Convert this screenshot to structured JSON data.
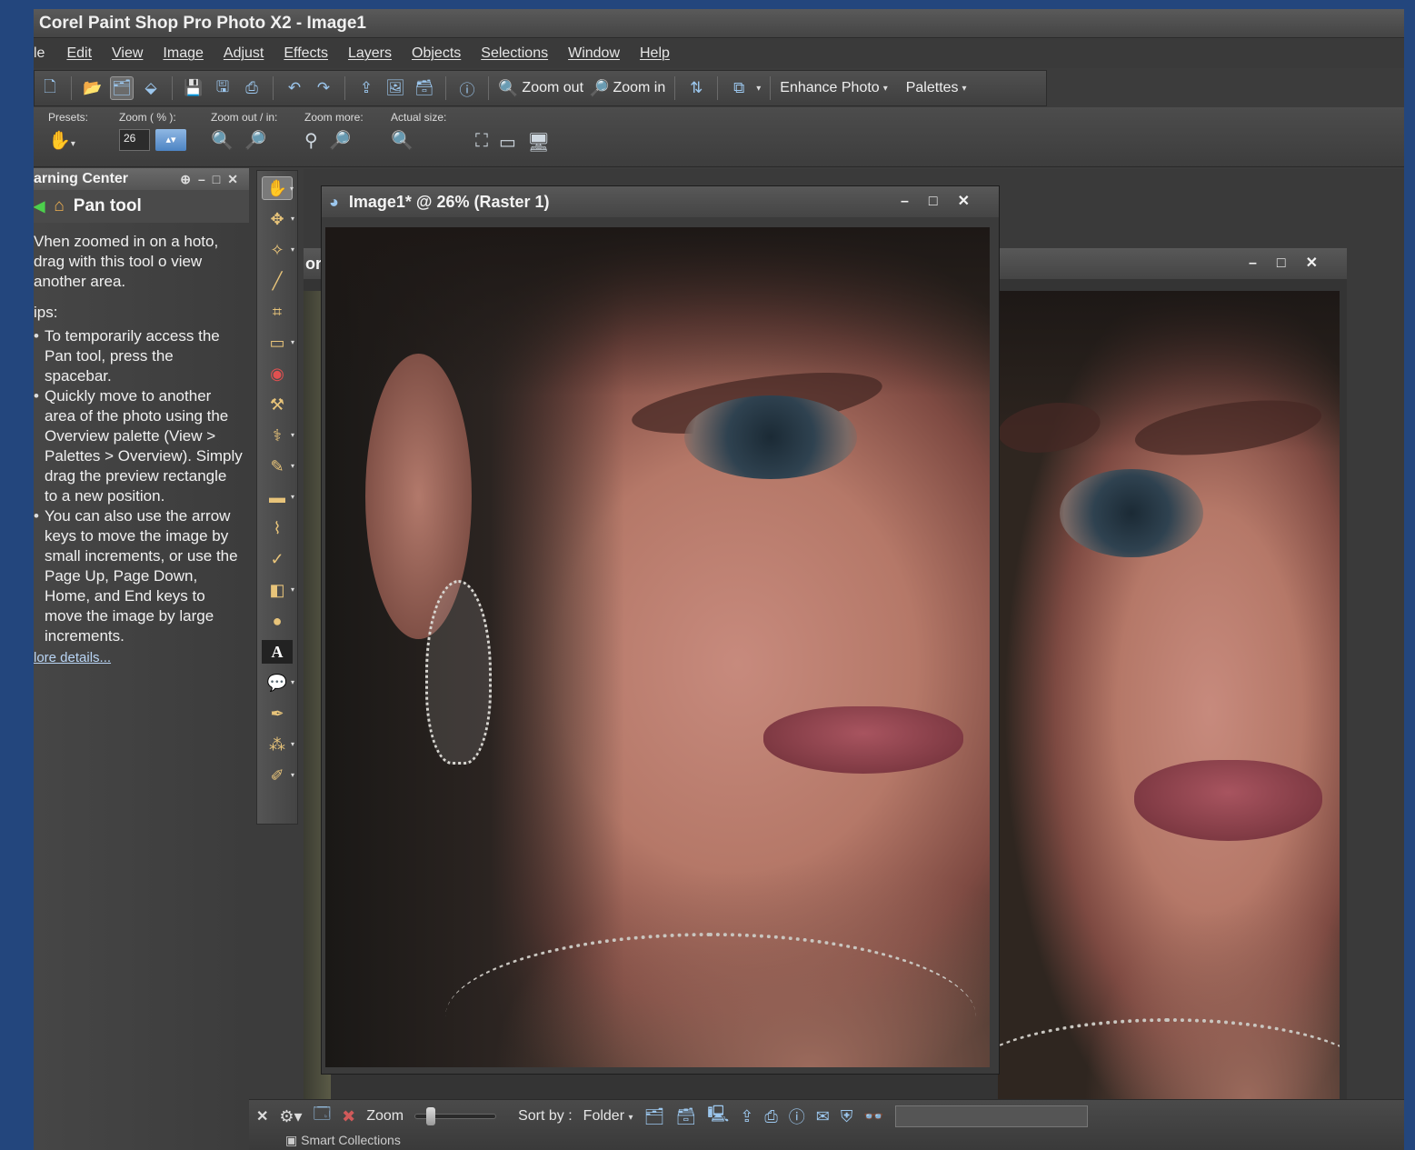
{
  "window": {
    "title": "Corel Paint Shop Pro Photo X2 - Image1"
  },
  "menu": [
    "le",
    "Edit",
    "View",
    "Image",
    "Adjust",
    "Effects",
    "Layers",
    "Objects",
    "Selections",
    "Window",
    "Help"
  ],
  "toolbar": {
    "zoom_out": "Zoom out",
    "zoom_in": "Zoom in",
    "enhance_photo": "Enhance Photo",
    "palettes": "Palettes"
  },
  "tool_options": {
    "presets_label": "Presets:",
    "zoom_label": "Zoom ( % ):",
    "zoom_value": "26",
    "zoom_out_in_label": "Zoom out / in:",
    "zoom_more_label": "Zoom more:",
    "actual_size_label": "Actual size:"
  },
  "learning_center": {
    "title": "arning Center",
    "tool_name": "Pan tool",
    "description": "Vhen zoomed in on a hoto, drag with this tool o view another area.",
    "tips_label": "ips:",
    "tips": [
      "To temporarily access the Pan tool, press the spacebar.",
      "Quickly move to another area of the photo using the Overview palette (View > Palettes > Overview). Simply drag the preview rectangle to a new position.",
      "You can also use the arrow keys to move the image by small increments, or use the Page Up, Page Down, Home, and End keys to move the image by large increments."
    ],
    "more_link": "lore details..."
  },
  "document": {
    "title": "Image1* @ 26% (Raster 1)",
    "zoom_percent": 26
  },
  "background_window": {
    "title_fragment": "ori"
  },
  "organizer": {
    "zoom_label": "Zoom",
    "zoom_level": 0.15,
    "sort_label": "Sort by :",
    "sort_value": "Folder",
    "smart_collections": "Smart Collections"
  }
}
